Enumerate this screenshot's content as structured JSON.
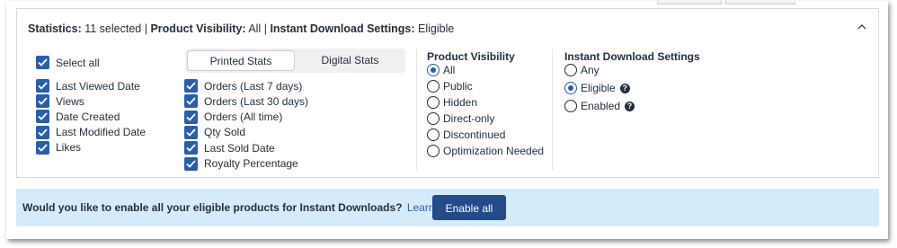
{
  "summary": {
    "statistics_label": "Statistics:",
    "statistics_value": "11 selected",
    "separator": "|",
    "visibility_label": "Product Visibility:",
    "visibility_value": "All",
    "instant_label": "Instant Download Settings:",
    "instant_value": "Eligible"
  },
  "stats": {
    "select_all": {
      "label": "Select all",
      "checked": true
    },
    "tabs": [
      {
        "label": "Printed Stats",
        "active": true
      },
      {
        "label": "Digital Stats",
        "active": false
      }
    ],
    "left_column": [
      {
        "label": "Last Viewed Date",
        "checked": true
      },
      {
        "label": "Views",
        "checked": true
      },
      {
        "label": "Date Created",
        "checked": true
      },
      {
        "label": "Last Modified Date",
        "checked": true
      },
      {
        "label": "Likes",
        "checked": true
      }
    ],
    "right_column": [
      {
        "label": "Orders (Last 7 days)",
        "checked": true
      },
      {
        "label": "Orders (Last 30 days)",
        "checked": true
      },
      {
        "label": "Orders (All time)",
        "checked": true
      },
      {
        "label": "Qty Sold",
        "checked": true
      },
      {
        "label": "Last Sold Date",
        "checked": true
      },
      {
        "label": "Royalty Percentage",
        "checked": true
      }
    ]
  },
  "visibility": {
    "title": "Product Visibility",
    "options": [
      {
        "label": "All",
        "checked": true
      },
      {
        "label": "Public",
        "checked": false
      },
      {
        "label": "Hidden",
        "checked": false
      },
      {
        "label": "Direct-only",
        "checked": false
      },
      {
        "label": "Discontinued",
        "checked": false
      },
      {
        "label": "Optimization Needed",
        "checked": false
      }
    ]
  },
  "instant": {
    "title": "Instant Download Settings",
    "options": [
      {
        "label": "Any",
        "checked": false,
        "help": false
      },
      {
        "label": "Eligible",
        "checked": true,
        "help": true
      },
      {
        "label": "Enabled",
        "checked": false,
        "help": true
      }
    ],
    "help_glyph": "?"
  },
  "banner": {
    "question": "Would you like to enable all your eligible products for Instant Downloads?",
    "learn_more": "Learn more",
    "button": "Enable all"
  },
  "colors": {
    "accent": "#2b5ea7",
    "button": "#234b8b",
    "banner_bg": "#d4ebfb",
    "text": "#232f3e"
  }
}
